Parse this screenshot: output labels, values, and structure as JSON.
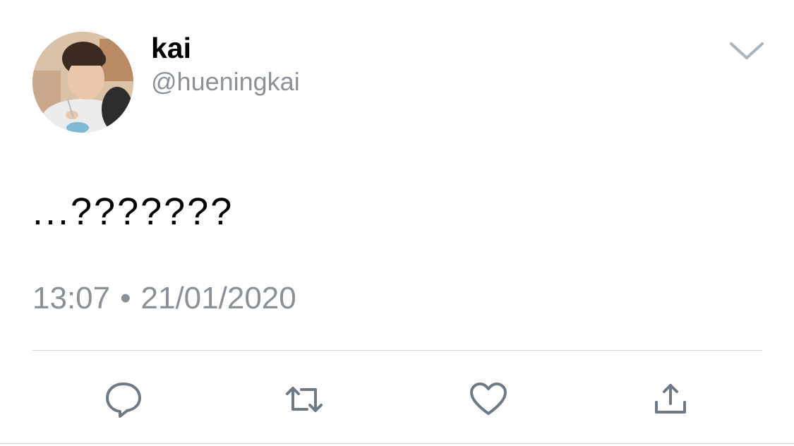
{
  "user": {
    "display_name": "kai",
    "handle": "@hueningkai"
  },
  "tweet": {
    "text": "...???????",
    "time": "13:07",
    "separator": "•",
    "date": "21/01/2020"
  },
  "icons": {
    "menu": "chevron-down-icon",
    "reply": "reply-bubble-icon",
    "retweet": "retweet-icon",
    "like": "heart-icon",
    "share": "share-upload-icon"
  },
  "colors": {
    "secondary_text": "#8a9199",
    "icon": "#6e7a86",
    "divider": "#cfd5da"
  }
}
